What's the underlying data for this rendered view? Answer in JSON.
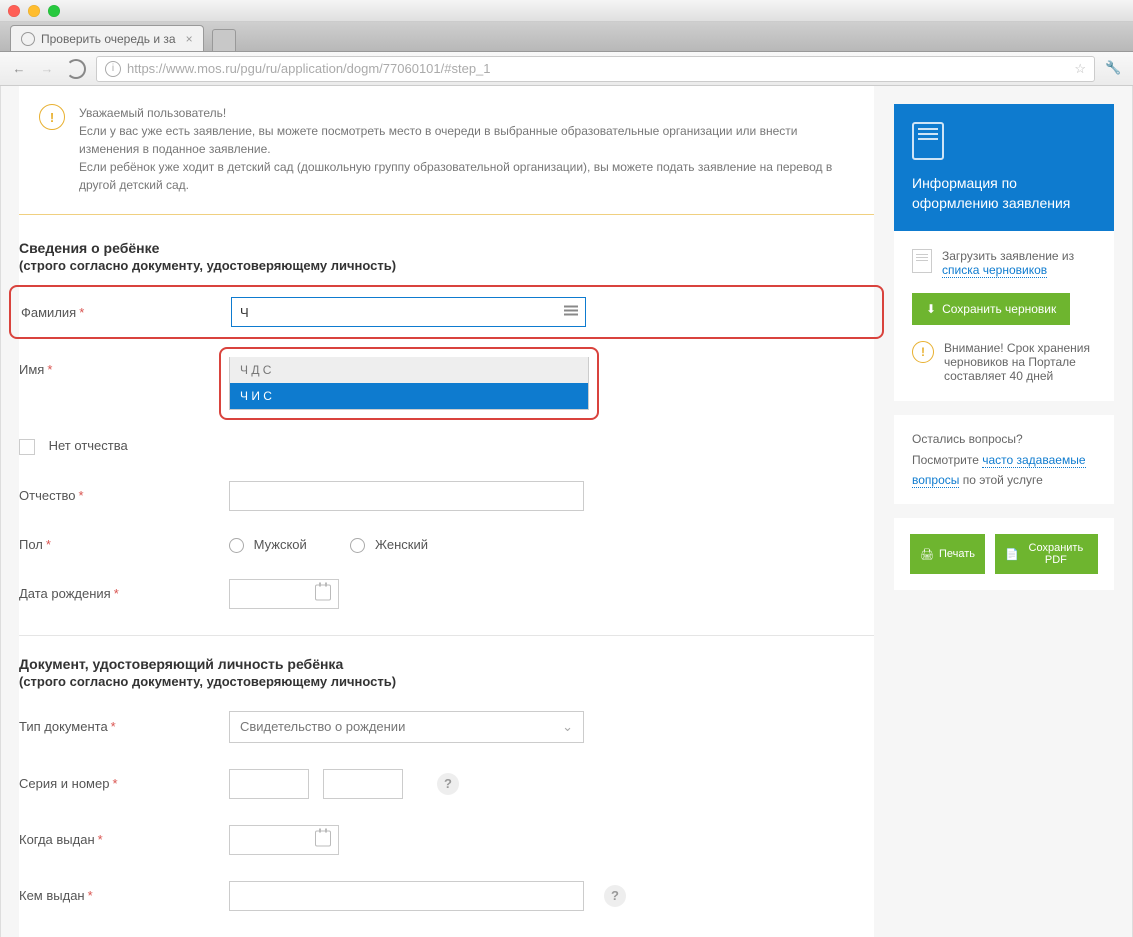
{
  "browser": {
    "tab_title": "Проверить очередь и за",
    "url": "https://www.mos.ru/pgu/ru/application/dogm/77060101/#step_1"
  },
  "notice": {
    "line1": "Уважаемый пользователь!",
    "line2": "Если у вас уже есть заявление, вы можете посмотреть место в очереди в выбранные образовательные организации или внести изменения в поданное заявление.",
    "line3": "Если ребёнок уже ходит в детский сад (дошкольную группу образовательной организации), вы можете подать заявление на перевод в другой детский сад."
  },
  "section1": {
    "title": "Сведения о ребёнке",
    "subtitle": "(строго согласно документу, удостоверяющему личность)"
  },
  "fields": {
    "surname_label": "Фамилия",
    "surname_value": "Ч",
    "name_label": "Имя",
    "no_patronymic_label": "Нет отчества",
    "patronymic_label": "Отчество",
    "gender_label": "Пол",
    "gender_male": "Мужской",
    "gender_female": "Женский",
    "birthdate_label": "Дата рождения"
  },
  "autocomplete": {
    "item1": "Ч            Д         С",
    "item2": "Ч         И      С"
  },
  "section2": {
    "title": "Документ, удостоверяющий личность ребёнка",
    "subtitle": "(строго согласно документу, удостоверяющему личность)",
    "doctype_label": "Тип документа",
    "doctype_value": "Свидетельство о рождении",
    "series_label": "Серия и номер",
    "issued_date_label": "Когда выдан",
    "issued_by_label": "Кем выдан"
  },
  "sidebar": {
    "header_title": "Информация по оформлению заявления",
    "load_draft_text": "Загрузить заявление из ",
    "drafts_link": "списка черновиков",
    "save_draft_btn": "Сохранить черновик",
    "warn_text": "Внимание! Срок хранения черновиков на Портале составляет 40 дней",
    "faq_q": "Остались вопросы?",
    "faq_text": "Посмотрите ",
    "faq_link": "часто задаваемые вопросы",
    "faq_suffix": " по этой услуге",
    "print_btn": "Печать",
    "pdf_btn": "Сохранить PDF",
    "help_glyph": "?",
    "exclaim": "!"
  }
}
